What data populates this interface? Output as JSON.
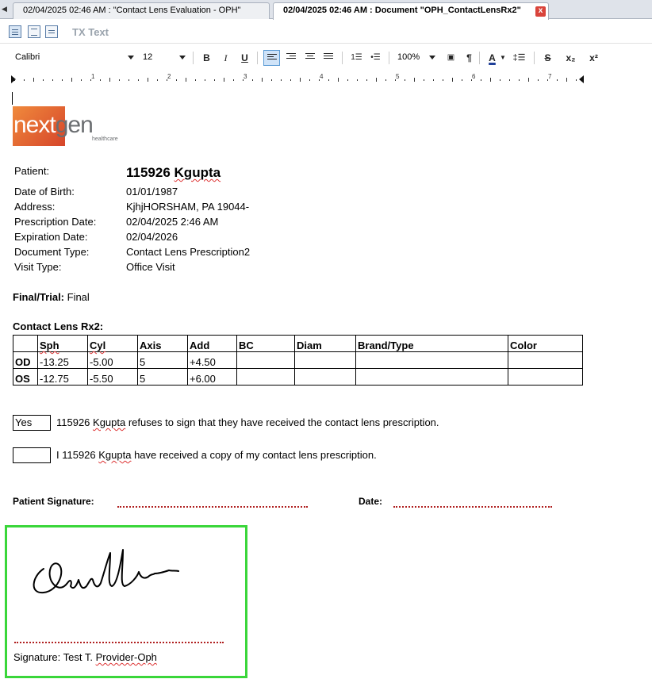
{
  "tabs": [
    {
      "label": "02/04/2025 02:46 AM : \"Contact Lens Evaluation - OPH\"",
      "active": false
    },
    {
      "label": "02/04/2025 02:46 AM  : Document \"OPH_ContactLensRx2\"",
      "active": true
    }
  ],
  "tab_close": "x",
  "mode_bar": {
    "label": "TX Text"
  },
  "toolbar": {
    "font": "Calibri",
    "size": "12",
    "bold": "B",
    "italic": "I",
    "underline": "U",
    "zoom": "100%",
    "pilcrow": "¶",
    "font_color": "A",
    "strike": "S",
    "subscript": "x₂",
    "superscript": "x²"
  },
  "ruler": {
    "numbers": [
      "1",
      "2",
      "3",
      "4",
      "5",
      "6",
      "7"
    ]
  },
  "logo": {
    "text_a": "next",
    "text_b": "gen",
    "sub": "healthcare"
  },
  "patient": {
    "label": "Patient:",
    "name_id": "115926",
    "name_last": "Kgupta"
  },
  "fields": [
    {
      "label": "Date of Birth:",
      "value": "01/01/1987"
    },
    {
      "label": "Address:",
      "value": "KjhjHORSHAM, PA  19044-"
    },
    {
      "label": "Prescription Date:",
      "value": "02/04/2025 2:46 AM"
    },
    {
      "label": "Expiration Date:",
      "value": "02/04/2026"
    },
    {
      "label": "Document Type:",
      "value": "Contact Lens Prescription2"
    },
    {
      "label": "Visit Type:",
      "value": "Office Visit"
    }
  ],
  "final_trial": {
    "label": "Final/Trial:",
    "value": " Final"
  },
  "rx": {
    "heading": "Contact Lens Rx2:",
    "headers": [
      "",
      "Sph",
      "Cyl",
      "Axis",
      "Add",
      "BC",
      "Diam",
      "Brand/Type",
      "Color"
    ],
    "rows": [
      [
        "OD",
        "-13.25",
        "-5.00",
        "5",
        "+4.50",
        "",
        "",
        "",
        ""
      ],
      [
        "OS",
        "-12.75",
        "-5.50",
        "5",
        "+6.00",
        "",
        "",
        "",
        ""
      ]
    ]
  },
  "refuse": {
    "box_value": "Yes",
    "text_pre": "115926 ",
    "text_name": "Kgupta",
    "text_post": " refuses to sign that they have received the contact lens prescription."
  },
  "received": {
    "box_value": "",
    "text_pre": "I 115926 ",
    "text_name": "Kgupta",
    "text_post": " have received a copy of my contact lens prescription."
  },
  "signature_row": {
    "patient_label": "Patient Signature:",
    "date_label": "Date:"
  },
  "provider_signature": {
    "label": "Signature:  Test T. ",
    "name": "Provider-Oph"
  }
}
